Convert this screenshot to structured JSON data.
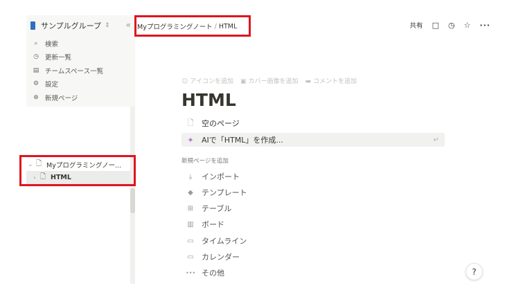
{
  "sidebar": {
    "workspace_name": "サンプルグループ",
    "workspace_toggle": "⇕",
    "collapse_icon": "«",
    "menu": [
      {
        "icon": "search-icon",
        "glyph": "⌕",
        "label": "検索"
      },
      {
        "icon": "clock-icon",
        "glyph": "◷",
        "label": "更新一覧"
      },
      {
        "icon": "teamspace-icon",
        "glyph": "▤",
        "label": "チームスペース一覧"
      },
      {
        "icon": "gear-icon",
        "glyph": "⚙",
        "label": "設定"
      },
      {
        "icon": "plus-circle-icon",
        "glyph": "⊕",
        "label": "新規ページ"
      }
    ],
    "tree": [
      {
        "chevron": "⌄",
        "label": "Myプログラミングノー..."
      },
      {
        "chevron": "›",
        "label": "HTML"
      }
    ]
  },
  "topbar": {
    "breadcrumb": [
      "Myプログラミングノート",
      "HTML"
    ],
    "breadcrumb_sep": "/",
    "share_label": "共有"
  },
  "page": {
    "options": [
      {
        "glyph": "☺",
        "label": "アイコンを追加"
      },
      {
        "glyph": "▣",
        "label": "カバー画像を追加"
      },
      {
        "glyph": "▬",
        "label": "コメントを追加"
      }
    ],
    "title": "HTML",
    "empty_page_label": "空のページ",
    "ai_label": "AIで「HTML」を作成...",
    "ai_enter": "↵",
    "add_new_label": "新規ページを追加",
    "templates": [
      {
        "icon": "import-icon",
        "glyph": "⤓",
        "label": "インポート"
      },
      {
        "icon": "template-icon",
        "glyph": "◆",
        "label": "テンプレート"
      },
      {
        "icon": "table-icon",
        "glyph": "⊞",
        "label": "テーブル"
      },
      {
        "icon": "board-icon",
        "glyph": "▥",
        "label": "ボード"
      },
      {
        "icon": "timeline-icon",
        "glyph": "▭",
        "label": "タイムライン"
      },
      {
        "icon": "calendar-icon",
        "glyph": "▭",
        "label": "カレンダー"
      },
      {
        "icon": "more-icon",
        "glyph": "•••",
        "label": "その他"
      }
    ]
  },
  "help_label": "?",
  "colors": {
    "highlight": "#e0141e",
    "sidebar_bg": "#f7f7f5",
    "ai_accent": "#a874d6"
  }
}
